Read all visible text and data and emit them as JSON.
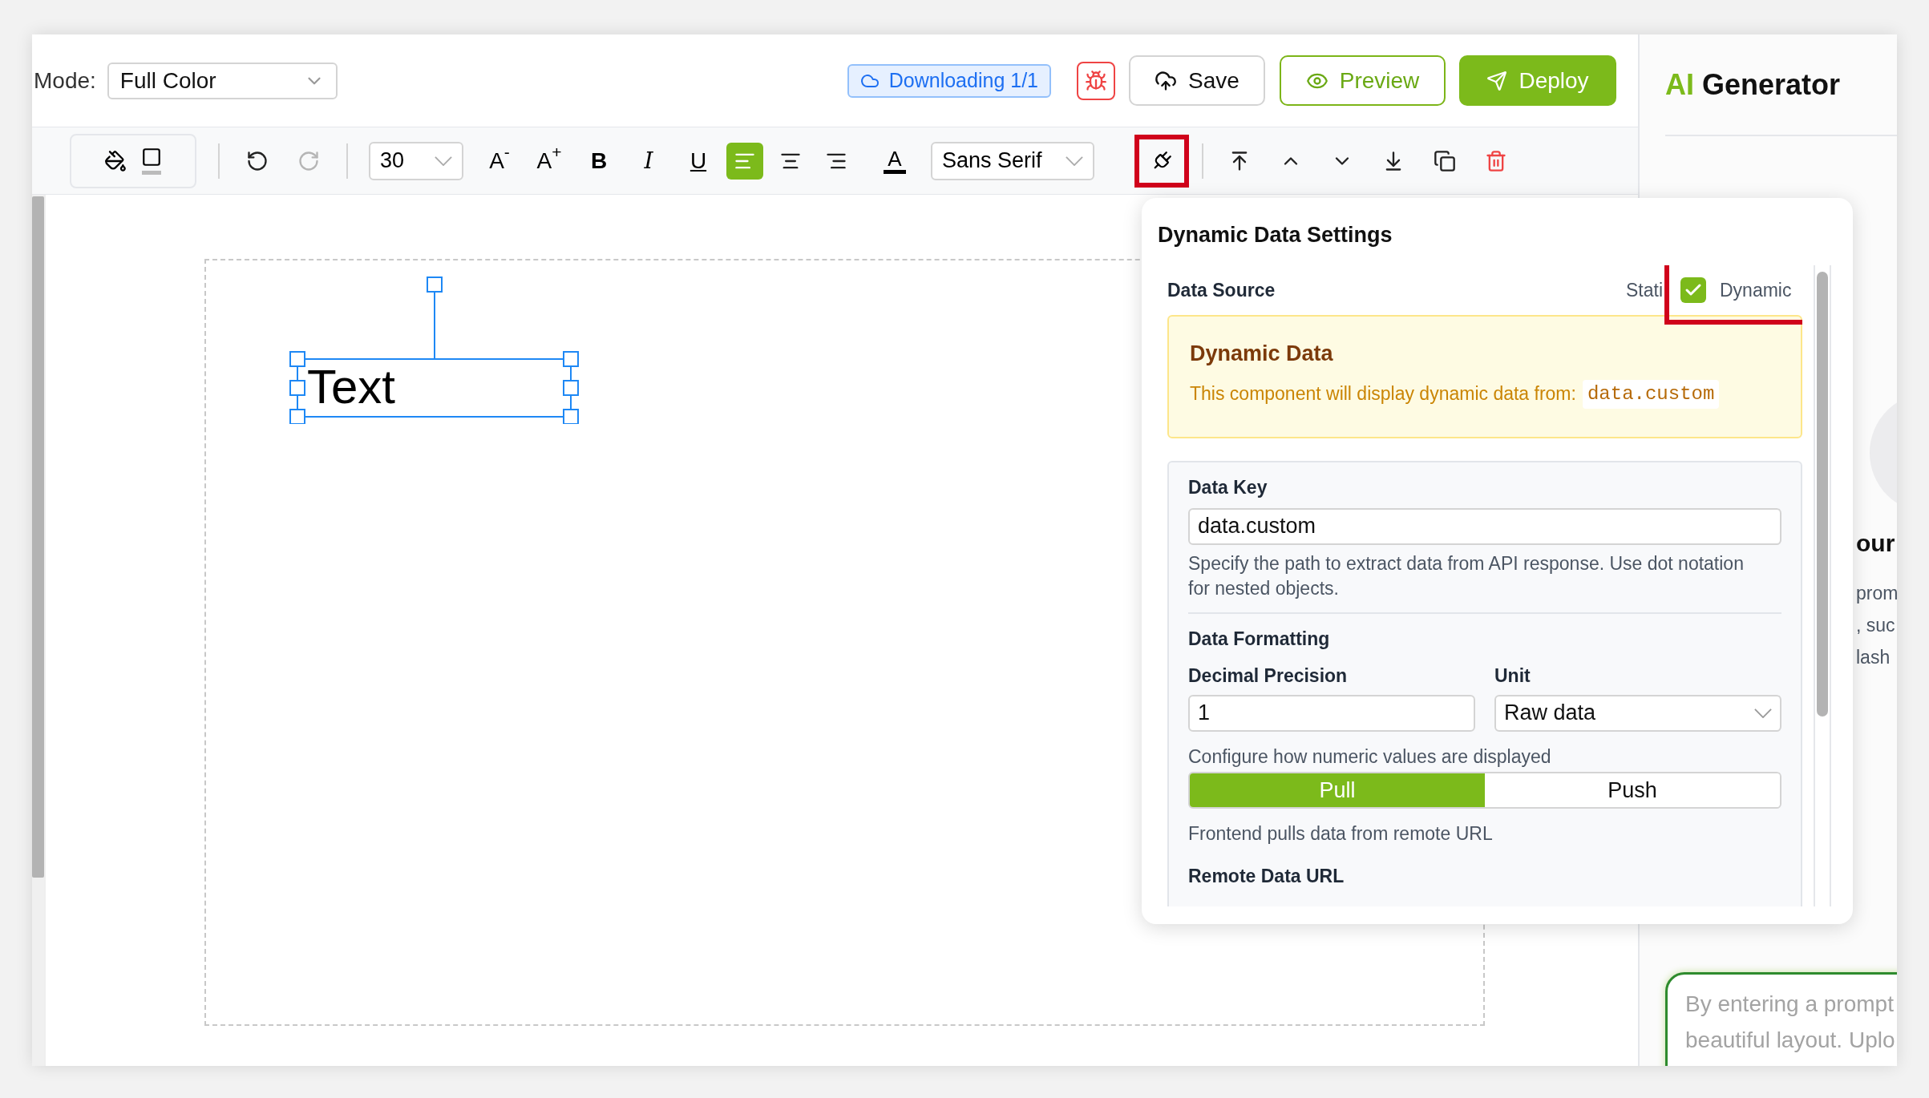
{
  "top_bar": {
    "mode_label": "Mode:",
    "mode": "Full Color",
    "status": "Downloading 1/1",
    "buttons": [
      {
        "kind": "debug"
      },
      {
        "kind": "save",
        "label": "Save"
      },
      {
        "kind": "preview",
        "label": "Preview"
      },
      {
        "kind": "deploy",
        "label": "Deploy"
      }
    ]
  },
  "toolbar": {
    "history": [
      {
        "kind": "undo",
        "disabled": false
      },
      {
        "kind": "redo",
        "disabled": true
      }
    ],
    "font_size": "30",
    "text_buttons": [
      {
        "kind": "shrink",
        "label": "A$^{-}$"
      },
      {
        "kind": "grow",
        "label": "A$^{+}$"
      },
      {
        "kind": "bold",
        "label": "B"
      },
      {
        "kind": "italic",
        "label": "I"
      },
      {
        "kind": "underline",
        "label": "U"
      }
    ],
    "alignment": [
      {
        "kind": "left",
        "selected": true
      },
      {
        "kind": "center",
        "selected": false
      },
      {
        "kind": "right",
        "selected": false
      }
    ],
    "text_color": "A",
    "font_family": "Sans Serif",
    "connect_highlighted": true,
    "arrange": [
      {
        "kind": "top"
      },
      {
        "kind": "up"
      },
      {
        "kind": "down"
      },
      {
        "kind": "bottom"
      },
      {
        "kind": "copy"
      },
      {
        "kind": "delete"
      }
    ]
  },
  "canvas": {
    "element_text": "Text",
    "selected": true
  },
  "popup": {
    "title": "Dynamic Data Settings",
    "data_source": {
      "label": "Data Source",
      "static_label": "Stati",
      "dynamic": true,
      "dynamic_label": "Dynamic",
      "highlighted": true
    },
    "notice": {
      "title": "Dynamic Data",
      "text": "This component will display dynamic data from:",
      "code": "data.custom"
    },
    "data_key": {
      "label": "Data Key",
      "value": "data.custom",
      "help": "Specify the path to extract data from API response. Use dot notation for nested objects."
    },
    "formatting": {
      "title": "Data Formatting",
      "precision": {
        "label": "Decimal Precision",
        "value": "1"
      },
      "unit": {
        "label": "Unit",
        "value": "Raw data"
      },
      "help": "Configure how numeric values are displayed"
    },
    "mode_options": [
      {
        "label": "Pull",
        "selected": true
      },
      {
        "label": "Push",
        "selected": false
      }
    ],
    "mode_help": "Frontend pulls data from remote URL",
    "next_label": "Remote Data URL"
  },
  "right_panel": {
    "title_accent": "AI",
    "title": "Generator",
    "heading": "our",
    "lines": [
      "prom",
      ", suc",
      "lash"
    ],
    "prompt_lines": [
      "By entering a prompt",
      "beautiful layout. Uplo"
    ]
  }
}
